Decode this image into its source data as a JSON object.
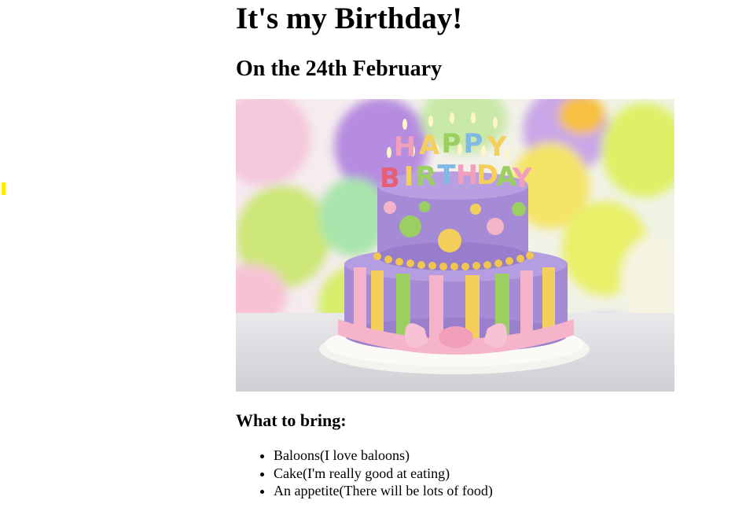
{
  "page": {
    "title": "It's my Birthday!",
    "subtitle": "On the 24th February"
  },
  "image": {
    "candle_text": "HAPPY BIRTHDAY",
    "alt": "Birthday cake"
  },
  "bring": {
    "heading": "What to bring:",
    "items": [
      "Baloons(I love baloons)",
      "Cake(I'm really good at eating)",
      "An appetite(There will be lots of food)"
    ]
  },
  "colors": {
    "marker": "#ffea00",
    "cake_purple": "#a58bd6",
    "cake_green": "#9ccf62",
    "cake_yellow": "#f4cf5b",
    "cake_pink": "#f3b3c8"
  }
}
